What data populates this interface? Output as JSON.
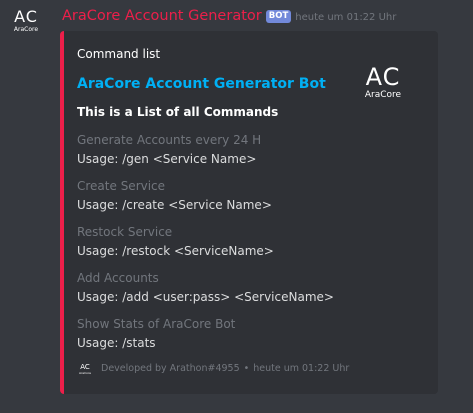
{
  "avatar": {
    "big": "AC",
    "small": "AraCore"
  },
  "header": {
    "author": "AraCore Account Generator",
    "badge": "BOT",
    "timestamp": "heute um 01:22 Uhr"
  },
  "embed": {
    "accent_color": "#ed1f4a",
    "author": "Command list",
    "title": "AraCore Account Generator Bot",
    "subtitle": "This is a List of all Commands",
    "thumbnail": {
      "big": "AC",
      "small": "AraCore"
    },
    "fields": [
      {
        "name": "Generate Accounts every 24 H",
        "value": "Usage: /gen <Service Name>"
      },
      {
        "name": "Create Service",
        "value": "Usage: /create <Service Name>"
      },
      {
        "name": "Restock Service",
        "value": "Usage: /restock <ServiceName>"
      },
      {
        "name": "Add Accounts",
        "value": "Usage: /add <user:pass> <ServiceName>"
      },
      {
        "name": "Show Stats of AraCore Bot",
        "value": "Usage: /stats"
      }
    ],
    "footer": {
      "icon": {
        "big": "AC",
        "small": "AraCore"
      },
      "text": "Developed by Arathon#4955",
      "separator": "•",
      "timestamp": "heute um 01:22 Uhr"
    }
  }
}
